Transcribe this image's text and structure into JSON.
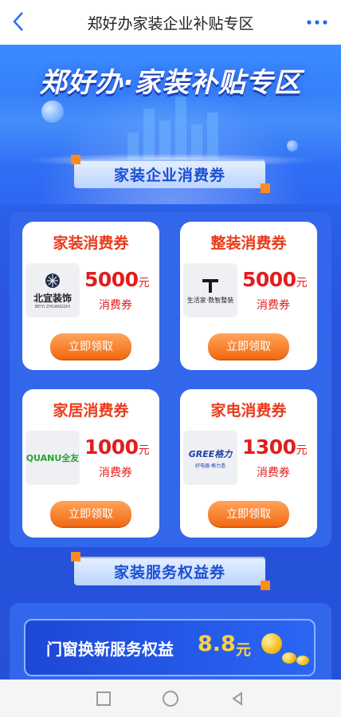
{
  "topbar": {
    "title": "郑好办家装企业补贴专区",
    "back_icon": "chevron-left-icon",
    "more_icon": "more-dots-icon"
  },
  "hero": {
    "title": "郑好办·家装补贴专区"
  },
  "section1": {
    "label": "家装企业消费券"
  },
  "cards": [
    {
      "title": "家装消费券",
      "amount": "5000",
      "unit": "元",
      "sub": "消费券",
      "button": "立即领取",
      "logo_text": "北宜装饰",
      "logo_sub": "BEIYI ZHUANGSHI"
    },
    {
      "title": "整装消费券",
      "amount": "5000",
      "unit": "元",
      "sub": "消费券",
      "button": "立即领取",
      "logo_text": "生活家·数智整装"
    },
    {
      "title": "家居消费券",
      "amount": "1000",
      "unit": "元",
      "sub": "消费券",
      "button": "立即领取",
      "logo_text": "QUANU全友"
    },
    {
      "title": "家电消费券",
      "amount": "1300",
      "unit": "元",
      "sub": "消费券",
      "button": "立即领取",
      "logo_text": "GREE格力",
      "logo_sub": "好电器·格力造"
    }
  ],
  "section2": {
    "label": "家装服务权益券"
  },
  "service": {
    "label": "门窗换新服务权益",
    "value": "8.8",
    "unit": "元"
  },
  "colors": {
    "primary_blue": "#2a63ea",
    "accent_red": "#e21d1d",
    "button_orange": "#f26a12",
    "service_gold": "#ffd23a"
  }
}
